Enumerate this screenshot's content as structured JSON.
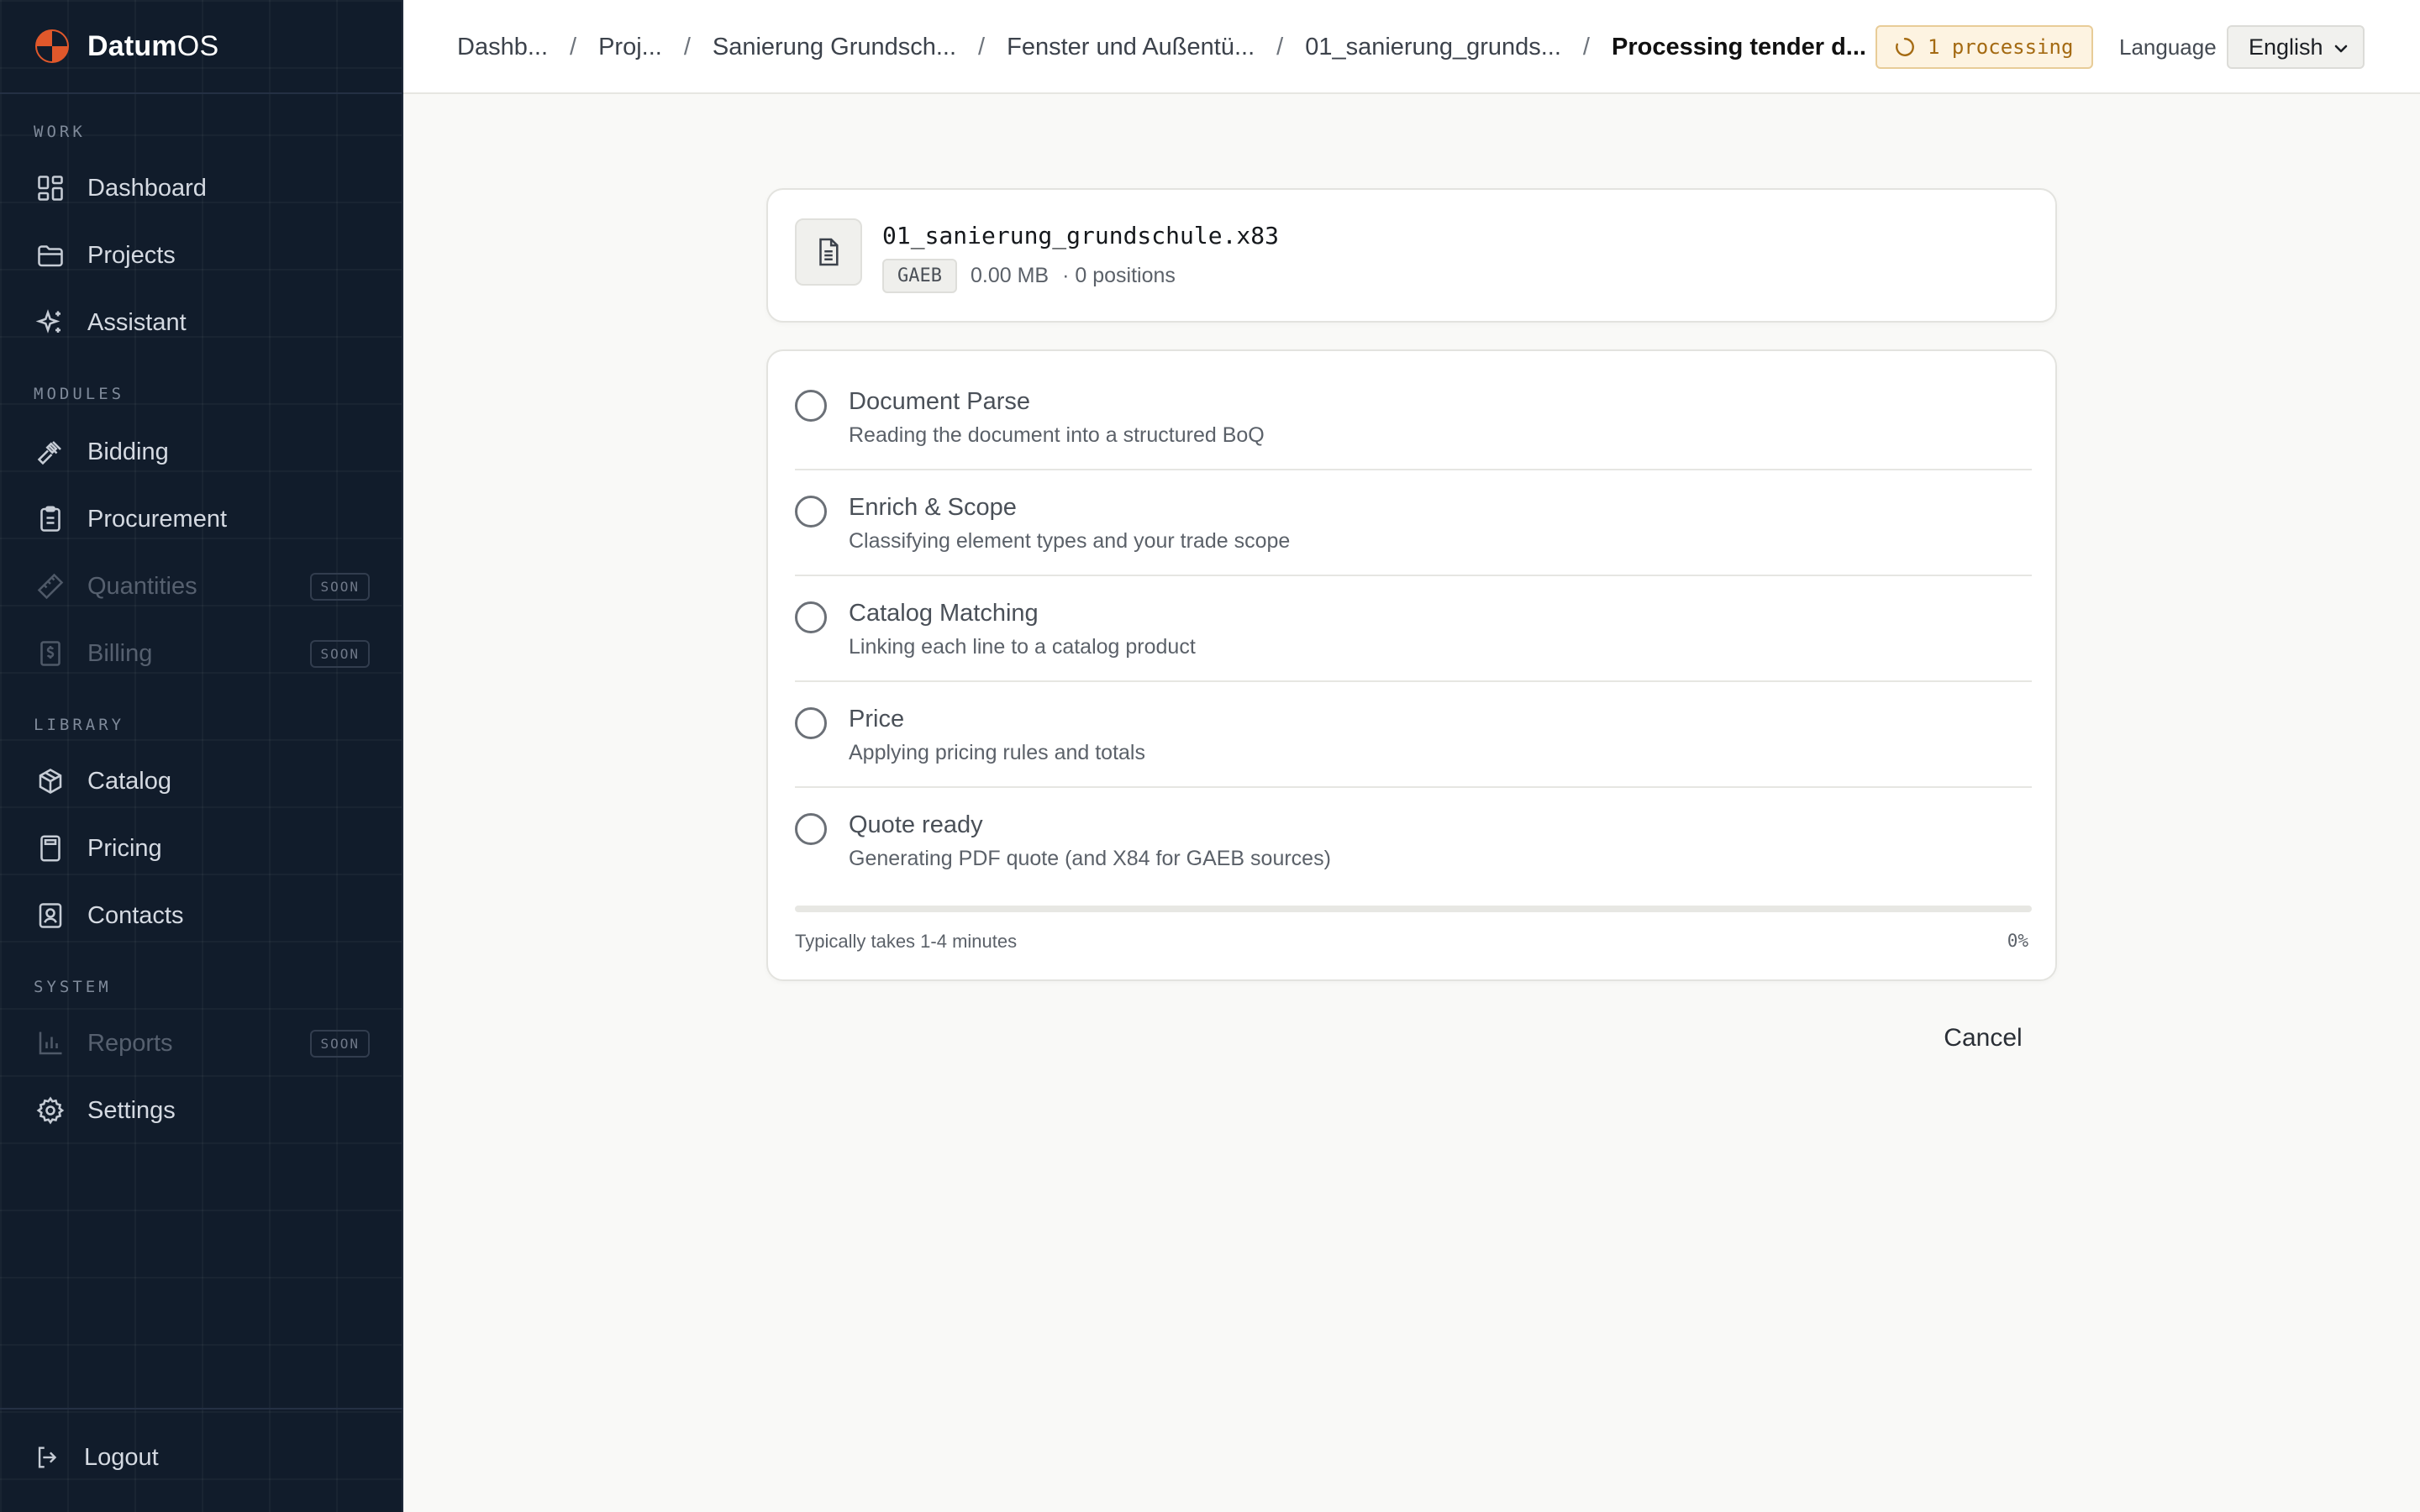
{
  "brand": {
    "name_bold": "Datum",
    "name_rest": "OS"
  },
  "colors": {
    "accent": "#e0582b",
    "sidebar_bg": "#111c2b",
    "processing_text": "#a46a12"
  },
  "sidebar": {
    "sections": [
      {
        "label": "WORK"
      },
      {
        "label": "MODULES"
      },
      {
        "label": "LIBRARY"
      },
      {
        "label": "SYSTEM"
      }
    ],
    "items": [
      {
        "label": "Dashboard",
        "icon": "dashboard-icon"
      },
      {
        "label": "Projects",
        "icon": "folder-icon"
      },
      {
        "label": "Assistant",
        "icon": "sparkles-icon"
      },
      {
        "label": "Bidding",
        "icon": "gavel-icon"
      },
      {
        "label": "Procurement",
        "icon": "clipboard-icon"
      },
      {
        "label": "Quantities",
        "icon": "ruler-icon",
        "badge": "SOON",
        "disabled": true
      },
      {
        "label": "Billing",
        "icon": "receipt-dollar-icon",
        "badge": "SOON",
        "disabled": true
      },
      {
        "label": "Catalog",
        "icon": "box-icon"
      },
      {
        "label": "Pricing",
        "icon": "calculator-icon"
      },
      {
        "label": "Contacts",
        "icon": "contact-icon"
      },
      {
        "label": "Reports",
        "icon": "bar-chart-icon",
        "badge": "SOON",
        "disabled": true
      },
      {
        "label": "Settings",
        "icon": "gear-icon"
      }
    ],
    "logout": {
      "label": "Logout",
      "icon": "logout-icon"
    }
  },
  "topbar": {
    "breadcrumbs": [
      "Dashb...",
      "Proj...",
      "Sanierung Grundsch...",
      "Fenster und Außentü...",
      "01_sanierung_grunds...",
      "Processing tender d..."
    ],
    "processing_badge": "1 processing",
    "language_label": "Language",
    "language_value": "English"
  },
  "file": {
    "name": "01_sanierung_grundschule.x83",
    "type": "GAEB",
    "size": "0.00 MB",
    "positions": "· 0 positions",
    "icon": "document-icon"
  },
  "pipeline": {
    "steps": [
      {
        "title": "Document Parse",
        "description": "Reading the document into a structured BoQ"
      },
      {
        "title": "Enrich & Scope",
        "description": "Classifying element types and your trade scope"
      },
      {
        "title": "Catalog Matching",
        "description": "Linking each line to a catalog product"
      },
      {
        "title": "Price",
        "description": "Applying pricing rules and totals"
      },
      {
        "title": "Quote ready",
        "description": "Generating PDF quote (and X84 for GAEB sources)"
      }
    ],
    "progress_note": "Typically takes 1-4 minutes",
    "progress_percent": 0,
    "progress_label": "0%"
  },
  "actions": {
    "cancel": "Cancel"
  }
}
